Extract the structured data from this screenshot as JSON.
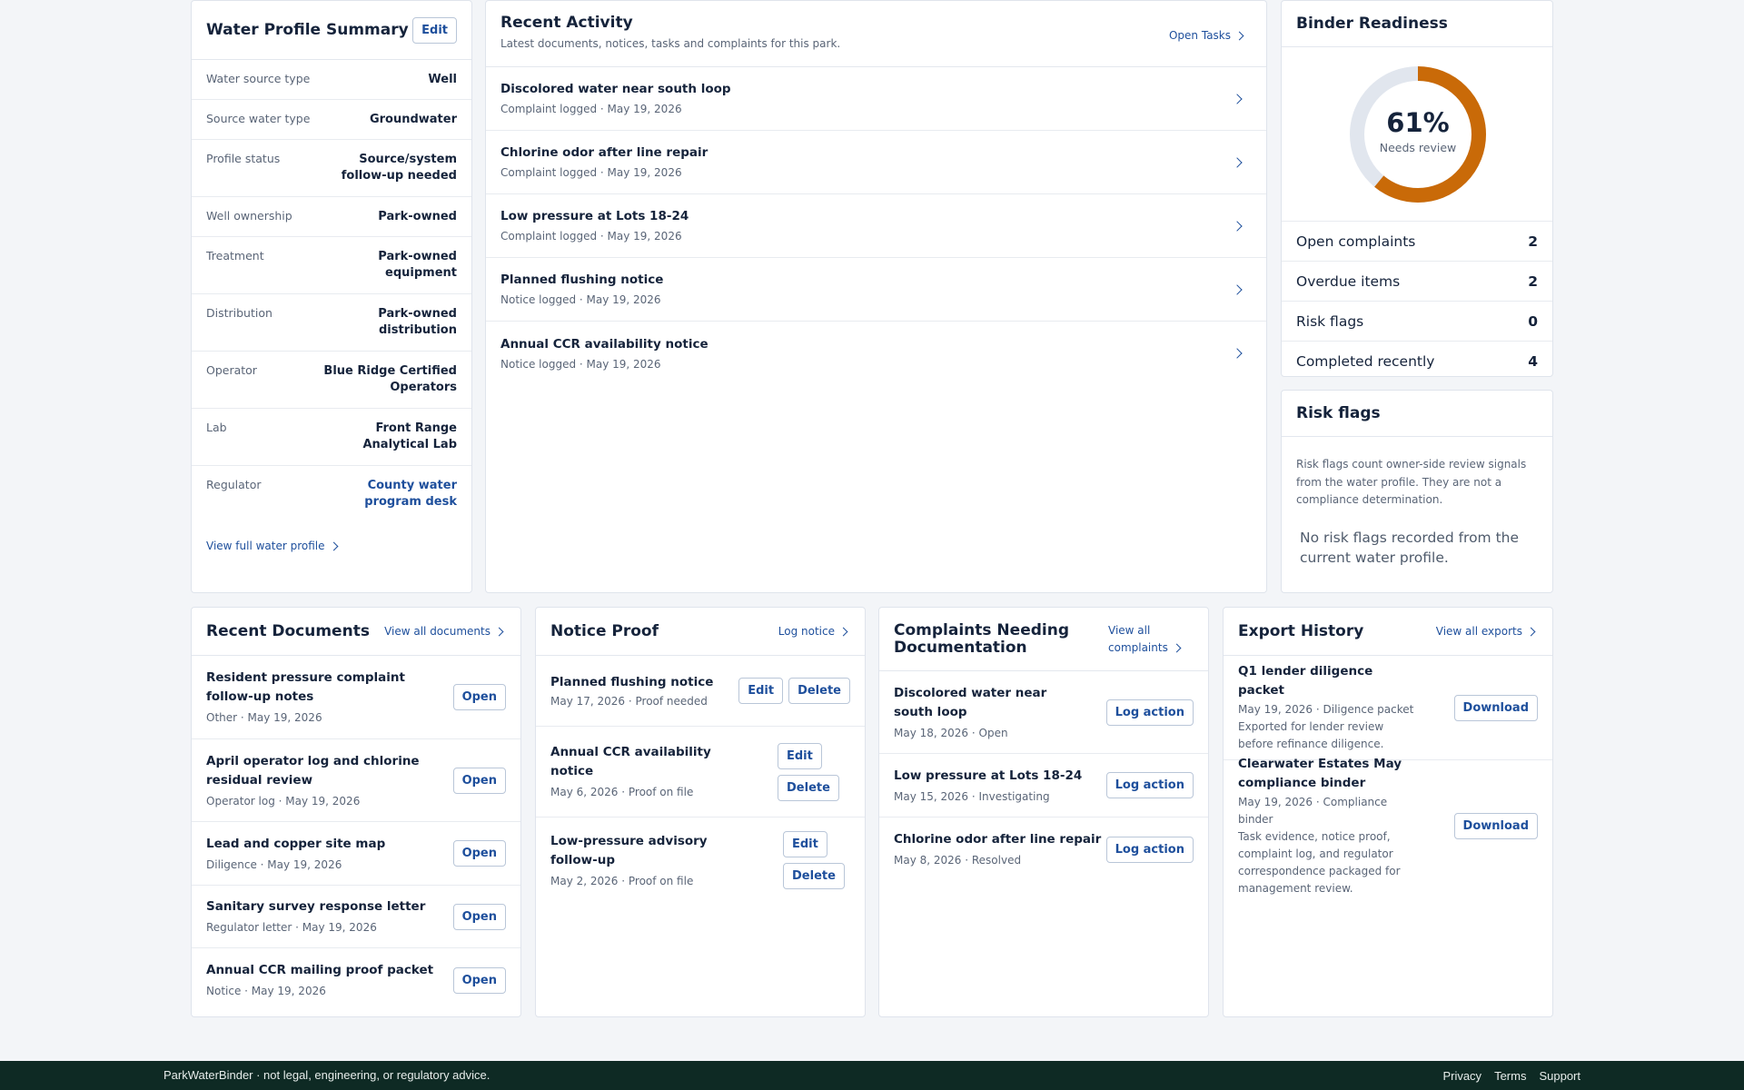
{
  "water_profile": {
    "title": "Water Profile Summary",
    "edit_label": "Edit",
    "rows": [
      {
        "key": "Water source type",
        "value": "Well"
      },
      {
        "key": "Source water type",
        "value": "Groundwater"
      },
      {
        "key": "Profile status",
        "value": "Source/system follow-up needed"
      },
      {
        "key": "Well ownership",
        "value": "Park-owned"
      },
      {
        "key": "Treatment",
        "value": "Park-owned equipment"
      },
      {
        "key": "Distribution",
        "value": "Park-owned distribution"
      },
      {
        "key": "Operator",
        "value": "Blue Ridge Certified Operators"
      },
      {
        "key": "Lab",
        "value": "Front Range Analytical Lab"
      },
      {
        "key": "Regulator",
        "value": "County water program desk"
      }
    ],
    "view_link": "View full water profile"
  },
  "recent_activity": {
    "title": "Recent Activity",
    "subtitle": "Latest documents, notices, tasks and complaints for this park.",
    "open_tasks": "Open Tasks",
    "items": [
      {
        "title": "Discolored water near south loop",
        "meta": "Complaint logged · May 19, 2026"
      },
      {
        "title": "Chlorine odor after line repair",
        "meta": "Complaint logged · May 19, 2026"
      },
      {
        "title": "Low pressure at Lots 18-24",
        "meta": "Complaint logged · May 19, 2026"
      },
      {
        "title": "Planned flushing notice",
        "meta": "Notice logged · May 19, 2026"
      },
      {
        "title": "Annual CCR availability notice",
        "meta": "Notice logged · May 19, 2026"
      }
    ]
  },
  "binder": {
    "title": "Binder Readiness",
    "percent": 61,
    "percent_label": "61%",
    "status": "Needs review",
    "ring_color": "#c96a08",
    "track_color": "#e1e6ee",
    "stats": [
      {
        "label": "Open complaints",
        "value": "2"
      },
      {
        "label": "Overdue items",
        "value": "2"
      },
      {
        "label": "Risk flags",
        "value": "0"
      },
      {
        "label": "Completed recently",
        "value": "4"
      }
    ]
  },
  "risk_flags": {
    "title": "Risk flags",
    "description": "Risk flags count owner-side review signals from the water profile. They are not a compliance determination.",
    "empty": "No risk flags recorded from the current water profile."
  },
  "recent_documents": {
    "title": "Recent Documents",
    "view_all": "View all documents",
    "open_label": "Open",
    "items": [
      {
        "title": "Resident pressure complaint follow-up notes",
        "meta": "Other · May 19, 2026"
      },
      {
        "title": "April operator log and chlorine residual review",
        "meta": "Operator log · May 19, 2026"
      },
      {
        "title": "Lead and copper site map",
        "meta": "Diligence · May 19, 2026"
      },
      {
        "title": "Sanitary survey response letter",
        "meta": "Regulator letter · May 19, 2026"
      },
      {
        "title": "Annual CCR mailing proof packet",
        "meta": "Notice · May 19, 2026"
      }
    ]
  },
  "notice_proof": {
    "title": "Notice Proof",
    "log_notice": "Log notice",
    "edit_label": "Edit",
    "delete_label": "Delete",
    "items": [
      {
        "title": "Planned flushing notice",
        "meta": "May 17, 2026 · Proof needed"
      },
      {
        "title": "Annual CCR availability notice",
        "meta": "May 6, 2026 · Proof on file"
      },
      {
        "title": "Low-pressure advisory follow-up",
        "meta": "May 2, 2026 · Proof on file"
      }
    ]
  },
  "complaints": {
    "title": "Complaints Needing Documentation",
    "view_all": "View all complaints",
    "action_label": "Log action",
    "items": [
      {
        "title": "Discolored water near south loop",
        "meta": "May 18, 2026 · Open"
      },
      {
        "title": "Low pressure at Lots 18-24",
        "meta": "May 15, 2026 · Investigating"
      },
      {
        "title": "Chlorine odor after line repair",
        "meta": "May 8, 2026 · Resolved"
      }
    ]
  },
  "exports": {
    "title": "Export History",
    "view_all": "View all exports",
    "download_label": "Download",
    "items": [
      {
        "title": "Q1 lender diligence packet",
        "meta": "May 19, 2026 · Diligence packet",
        "desc": "Exported for lender review before refinance diligence."
      },
      {
        "title": "Clearwater Estates May compliance binder",
        "meta": "May 19, 2026 · Compliance binder",
        "desc": "Task evidence, notice proof, complaint log, and regulator correspondence packaged for management review."
      }
    ]
  },
  "footer": {
    "disclaimer": "ParkWaterBinder · not legal, engineering, or regulatory advice.",
    "links": [
      "Privacy",
      "Terms",
      "Support"
    ]
  }
}
